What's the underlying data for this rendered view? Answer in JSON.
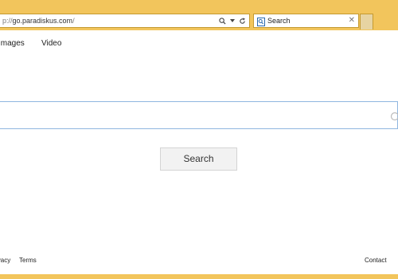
{
  "browser": {
    "address_prefix": "p://",
    "address_domain": "go.paradiskus.com",
    "address_suffix": "/",
    "search_box_label": "Search",
    "icons": [
      "search-icon",
      "dropdown-arrow-icon",
      "refresh-icon",
      "close-icon"
    ]
  },
  "page": {
    "nav": {
      "images": "Images",
      "video": "Video"
    },
    "query_value": "",
    "search_button": "Search",
    "footer": {
      "privacy": "Privacy",
      "terms": "Terms",
      "contact": "Contact"
    }
  },
  "colors": {
    "chrome": "#f2c55c",
    "input_border": "#8fb6e0",
    "button_bg": "#f2f2f2"
  }
}
